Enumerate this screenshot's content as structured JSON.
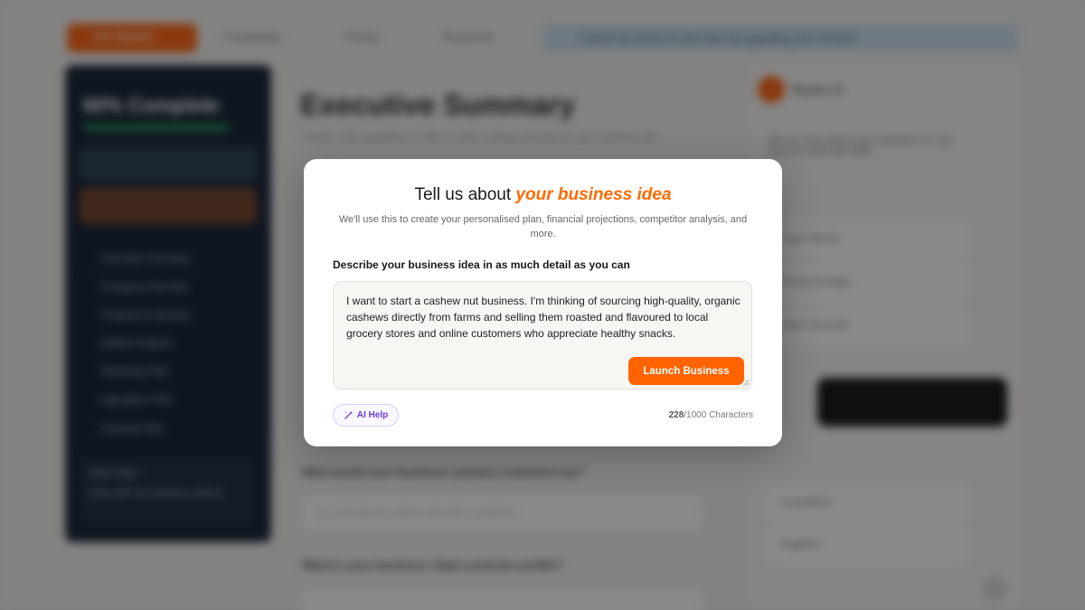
{
  "background": {
    "header": {
      "cta_label": "Get Started",
      "nav": [
        "Fundraising",
        "Pricing",
        "Resources"
      ],
      "banner_text": "Unlock full access to your plan by upgrading your account"
    },
    "sidebar": {
      "progress_title": "60% Complete",
      "items": [
        "Executive Summary",
        "Company Overview",
        "Products & Services",
        "Market Analysis",
        "Marketing Plan",
        "Operations Plan",
        "Financial Plan"
      ],
      "bottom_title": "Need help?",
      "bottom_text": "Chat with our business advisor"
    },
    "main": {
      "title": "Executive Summary",
      "subtitle": "Answer a few questions to help us write a strong summary for your business plan",
      "questions": [
        "Who would your business' primary customers be?",
        "What is your business' ideal customer profile?"
      ],
      "input_placeholder": "e.g. local grocery stores and online customers"
    },
    "right_panel": {
      "assistant_name": "Bizplanr AI",
      "intro": "Tell me more about your business so I can help you write your plan",
      "options": [
        "Target Market",
        "Pricing Strategy",
        "Sales Channels",
        "Competitors",
        "Suppliers"
      ]
    }
  },
  "modal": {
    "title_prefix": "Tell us about ",
    "title_accent": "your business idea",
    "description": "We'll use this to create your personalised plan, financial projections, competitor analysis, and more.",
    "field_label": "Describe your business idea in as much detail as you can",
    "textarea_value": "I want to start a cashew nut business. I'm thinking of sourcing high-quality, organic cashews directly from farms and selling them roasted and flavoured to local grocery stores and online customers who appreciate healthy snacks.",
    "launch_button": "Launch Business",
    "ai_help_label": "AI Help",
    "char_count": "228",
    "char_limit": "/1000 Characters"
  },
  "colors": {
    "accent": "#ff6300",
    "ai_purple": "#6b3ad6"
  },
  "icons": {
    "ai_help": "magic-wand-icon",
    "resize": "resize-grip-icon"
  }
}
